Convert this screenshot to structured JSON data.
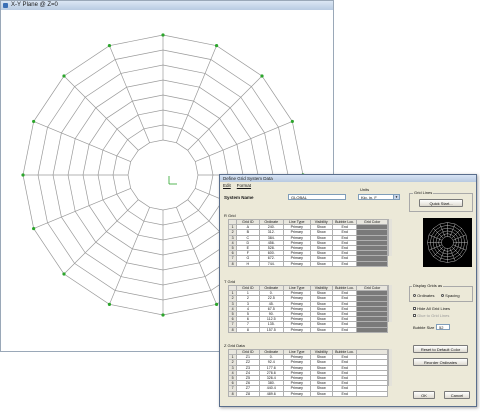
{
  "main_window": {
    "title": "X-Y Plane @ Z=0"
  },
  "dialog": {
    "title": "Define Grid System Data",
    "menu": [
      "Edit",
      "Format"
    ],
    "system_name_label": "System Name",
    "system_name_value": "GLOBAL",
    "units_label": "Units",
    "units_value": "Kip, in, F",
    "grid_lines_label": "Grid Lines",
    "quick_start_label": "Quick Start...",
    "r_grid": {
      "label": "R Grid",
      "headers": [
        "Grid ID",
        "Ordinate",
        "Line Type",
        "Visibility",
        "Bubble Loc.",
        "Grid Color"
      ],
      "rows": [
        [
          "1",
          "A",
          "240.",
          "Primary",
          "Show",
          "End"
        ],
        [
          "2",
          "B",
          "312.",
          "Primary",
          "Show",
          "End"
        ],
        [
          "3",
          "C",
          "384.",
          "Primary",
          "Show",
          "End"
        ],
        [
          "4",
          "D",
          "456.",
          "Primary",
          "Show",
          "End"
        ],
        [
          "5",
          "E",
          "528.",
          "Primary",
          "Show",
          "End"
        ],
        [
          "6",
          "F",
          "600.",
          "Primary",
          "Show",
          "End"
        ],
        [
          "7",
          "G",
          "672.",
          "Primary",
          "Show",
          "End"
        ],
        [
          "8",
          "H",
          "744.",
          "Primary",
          "Show",
          "End"
        ]
      ]
    },
    "t_grid": {
      "label": "T Grid",
      "headers": [
        "Grid ID",
        "Ordinate",
        "Line Type",
        "Visibility",
        "Bubble Loc.",
        "Grid Color"
      ],
      "rows": [
        [
          "1",
          "1",
          "0.",
          "Primary",
          "Show",
          "End"
        ],
        [
          "2",
          "2",
          "22.5",
          "Primary",
          "Show",
          "End"
        ],
        [
          "3",
          "3",
          "45.",
          "Primary",
          "Show",
          "End"
        ],
        [
          "4",
          "4",
          "67.5",
          "Primary",
          "Show",
          "End"
        ],
        [
          "5",
          "5",
          "90.",
          "Primary",
          "Show",
          "End"
        ],
        [
          "6",
          "6",
          "112.5",
          "Primary",
          "Show",
          "End"
        ],
        [
          "7",
          "7",
          "135.",
          "Primary",
          "Show",
          "End"
        ],
        [
          "8",
          "8",
          "157.5",
          "Primary",
          "Show",
          "End"
        ]
      ]
    },
    "z_grid": {
      "label": "Z Grid Data",
      "headers": [
        "Grid ID",
        "Ordinate",
        "Line Type",
        "Visibility",
        "Bubble Loc."
      ],
      "rows": [
        [
          "1",
          "Z1",
          "0.",
          "Primary",
          "Show",
          "End"
        ],
        [
          "2",
          "Z2",
          "92.4",
          "Primary",
          "Show",
          "End"
        ],
        [
          "3",
          "Z3",
          "177.6",
          "Primary",
          "Show",
          "End"
        ],
        [
          "4",
          "Z4",
          "276.6",
          "Primary",
          "Show",
          "End"
        ],
        [
          "5",
          "Z5",
          "326.4",
          "Primary",
          "Show",
          "End"
        ],
        [
          "6",
          "Z6",
          "380.",
          "Primary",
          "Show",
          "End"
        ],
        [
          "7",
          "Z7",
          "440.4",
          "Primary",
          "Show",
          "End"
        ],
        [
          "8",
          "Z8",
          "489.6",
          "Primary",
          "Show",
          "End"
        ]
      ]
    },
    "display_grids_label": "Display Grids as",
    "ordinates_label": "Ordinates",
    "spacing_label": "Spacing",
    "hide_all_label": "Hide All Grid Lines",
    "glue_label": "Glue to Grid Lines",
    "bubble_size_label": "Bubble Size",
    "bubble_size_value": "52",
    "reset_color_label": "Reset to Default Color",
    "reorder_label": "Reorder Ordinates",
    "ok_label": "OK",
    "cancel_label": "Cancel"
  },
  "colors": {
    "grid_line": "#9a9a9a",
    "bubble": "#2ca52c",
    "dialog_bg": "#ece9d8",
    "title_bar": "#c4d4ea"
  }
}
